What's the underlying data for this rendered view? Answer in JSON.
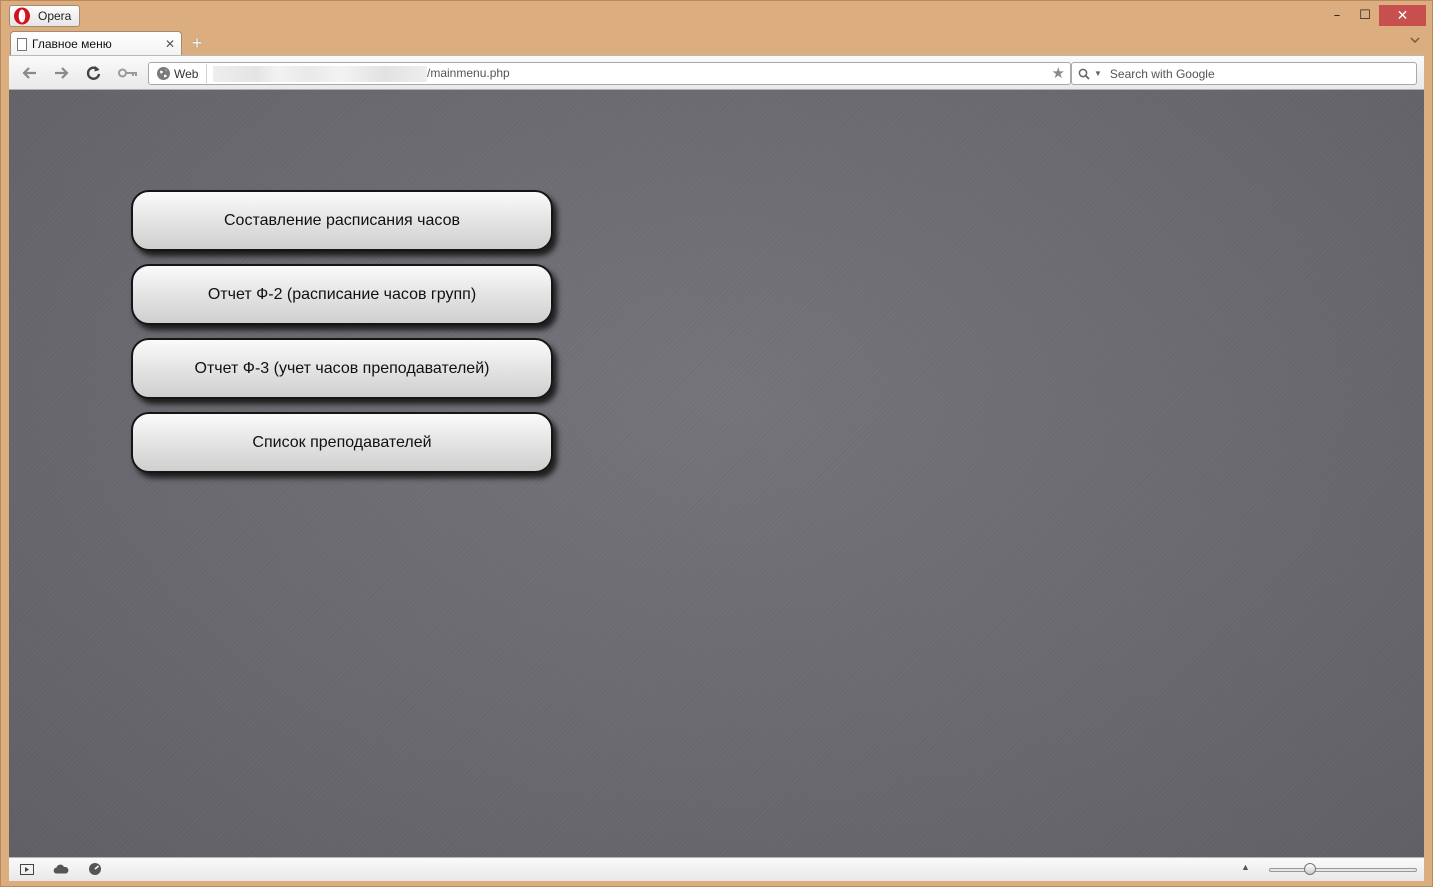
{
  "browser": {
    "menu_label": "Opera",
    "colors": {
      "frame": "#dcae7f",
      "close_button": "#c7504f",
      "content_bg": "#6a6a70"
    }
  },
  "window_controls": {
    "minimize": "–",
    "maximize": "☐",
    "close": "✕"
  },
  "tab": {
    "title": "Главное меню",
    "close": "✕",
    "new_tab": "+"
  },
  "toolbar": {
    "web_badge": "Web",
    "url_visible": "/mainmenu.php",
    "search_placeholder": "Search with Google"
  },
  "main_menu": {
    "buttons": [
      {
        "label": "Составление расписания часов"
      },
      {
        "label": "Отчет Ф-2 (расписание часов групп)"
      },
      {
        "label": "Отчет Ф-3 (учет часов преподавателей)"
      },
      {
        "label": "Список преподавателей"
      }
    ]
  }
}
